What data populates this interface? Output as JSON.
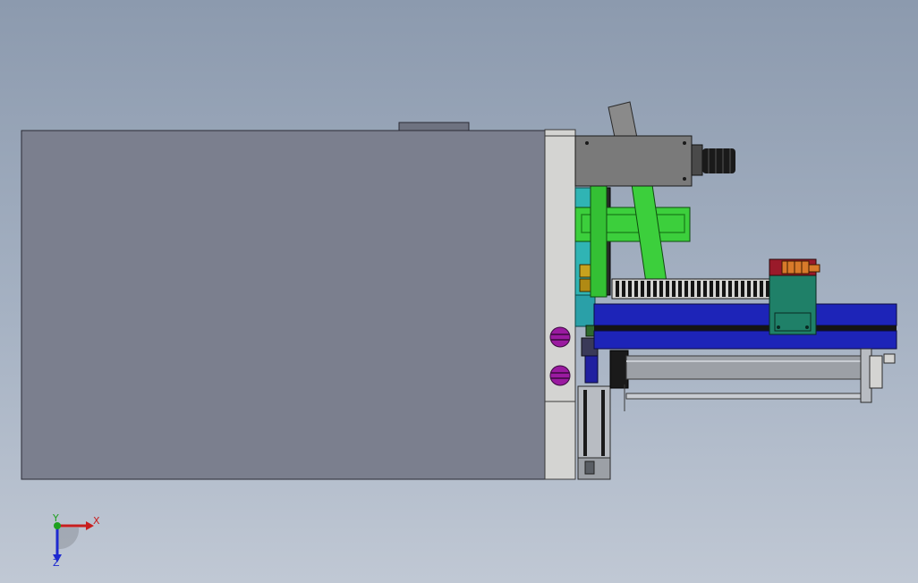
{
  "viewport": {
    "background_top": "#8c9aae",
    "background_bottom": "#c0c8d4"
  },
  "colors": {
    "housing": "#7b7f8e",
    "housing_edge": "#2a2a34",
    "end_plate": "#d4d4d2",
    "cyan_block": "#30b4b4",
    "green_arm": "#3ccf3c",
    "green_dark": "#1e8a1e",
    "blue_rail": "#1d24b8",
    "teal_block": "#1f8068",
    "rack_black": "#141414",
    "motor_grey": "#8a8a8a",
    "knob_black": "#1a1a1a",
    "purple_screw": "#9a1aa0",
    "cylinder_grey": "#9ca0a6",
    "orange_accent": "#d87a2a"
  },
  "triad": {
    "x_label": "X",
    "y_label": "Y",
    "z_label": "Z",
    "x_color": "#c81e1e",
    "y_color": "#1ea01e",
    "z_color": "#1e2ad0"
  }
}
